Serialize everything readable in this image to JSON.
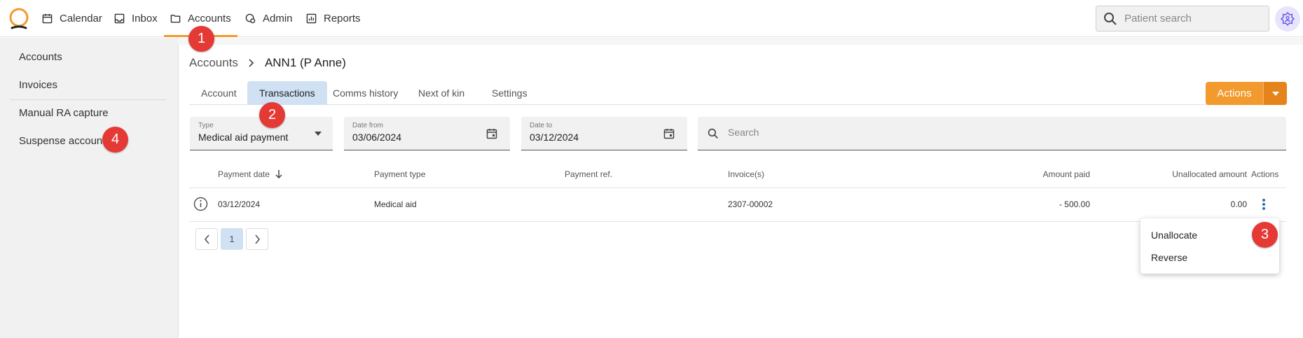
{
  "nav": {
    "items": [
      {
        "label": "Calendar",
        "icon": "calendar-icon"
      },
      {
        "label": "Inbox",
        "icon": "inbox-icon"
      },
      {
        "label": "Accounts",
        "icon": "folder-icon",
        "active": true
      },
      {
        "label": "Admin",
        "icon": "admin-icon"
      },
      {
        "label": "Reports",
        "icon": "reports-icon"
      }
    ],
    "search_placeholder": "Patient search",
    "accent_color": "#f29a2e"
  },
  "sidebar": {
    "items": [
      {
        "label": "Accounts"
      },
      {
        "label": "Invoices"
      },
      {
        "label": "Manual RA capture"
      },
      {
        "label": "Suspense account"
      }
    ]
  },
  "breadcrumb": {
    "parent": "Accounts",
    "current": "ANN1 (P Anne)"
  },
  "tabs": [
    {
      "label": "Account"
    },
    {
      "label": "Transactions",
      "active": true
    },
    {
      "label": "Comms history"
    },
    {
      "label": "Next of kin"
    },
    {
      "label": "Settings"
    }
  ],
  "actions_label": "Actions",
  "filters": {
    "type": {
      "label": "Type",
      "value": "Medical aid payment"
    },
    "date_from": {
      "label": "Date from",
      "value": "03/06/2024"
    },
    "date_to": {
      "label": "Date to",
      "value": "03/12/2024"
    },
    "search_placeholder": "Search"
  },
  "table": {
    "headers": {
      "payment_date": "Payment date",
      "payment_type": "Payment type",
      "payment_ref": "Payment ref.",
      "invoices": "Invoice(s)",
      "amount_paid": "Amount paid",
      "unallocated_amount": "Unallocated amount",
      "actions": "Actions"
    },
    "rows": [
      {
        "payment_date": "03/12/2024",
        "payment_type": "Medical aid",
        "payment_ref": "",
        "invoices": "2307-00002",
        "amount_paid": "- 500.00",
        "unallocated_amount": "0.00"
      }
    ]
  },
  "pagination": {
    "current_page": "1"
  },
  "row_menu": {
    "items": [
      {
        "label": "Unallocate"
      },
      {
        "label": "Reverse"
      }
    ]
  },
  "badges": [
    "1",
    "2",
    "3",
    "4"
  ],
  "colors": {
    "accent": "#f29a2e",
    "tab_active": "#cfe1f3",
    "badge": "#e53935",
    "admin_icon": "#6b5ce7"
  }
}
